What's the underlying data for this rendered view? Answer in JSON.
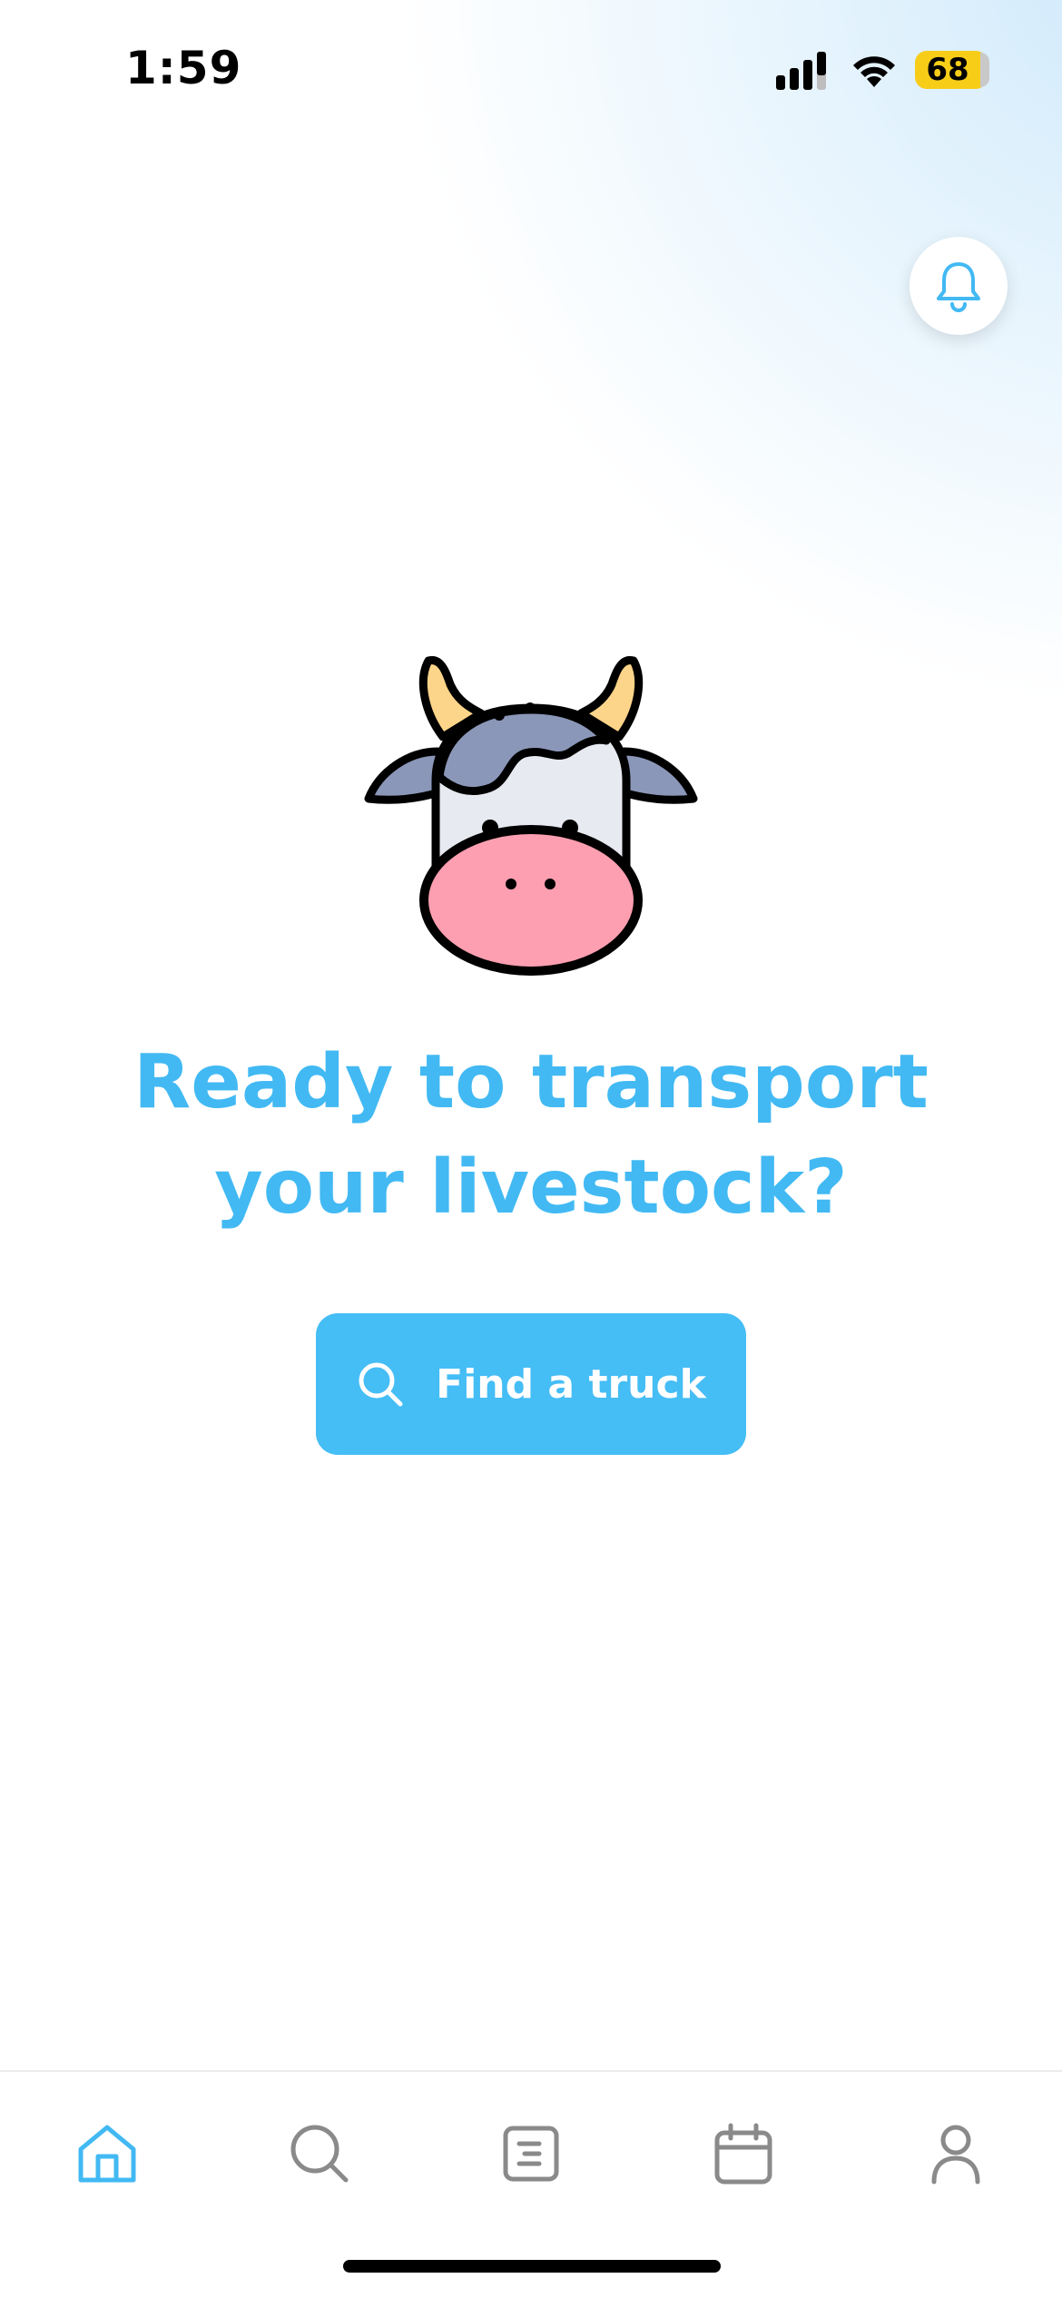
{
  "status_bar": {
    "time": "1:59",
    "battery_percent": "68",
    "icons": [
      "cellular-signal-icon",
      "wifi-icon",
      "battery-icon"
    ]
  },
  "header": {
    "notification_icon": "bell-icon"
  },
  "hero": {
    "illustration": "cow-face-illustration",
    "headline_line1": "Ready to transport",
    "headline_line2": "your livestock?",
    "cta_label": "Find a truck",
    "cta_icon": "search-icon"
  },
  "tab_bar": {
    "tabs": [
      {
        "icon": "home-icon",
        "active": true
      },
      {
        "icon": "search-icon",
        "active": false
      },
      {
        "icon": "document-list-icon",
        "active": false
      },
      {
        "icon": "calendar-icon",
        "active": false
      },
      {
        "icon": "profile-icon",
        "active": false
      }
    ]
  },
  "colors": {
    "accent": "#42b9f3",
    "button": "#45bdf5",
    "inactive_icon": "#8a8a8a",
    "battery": "#f7cd18"
  }
}
